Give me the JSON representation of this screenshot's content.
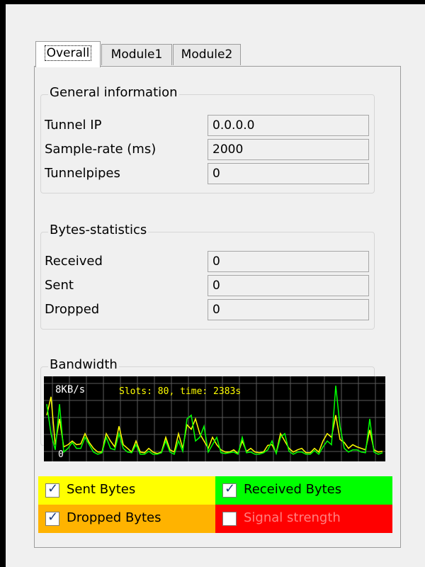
{
  "tabs": [
    {
      "label": "Overall",
      "active": true
    },
    {
      "label": "Module1",
      "active": false
    },
    {
      "label": "Module2",
      "active": false
    }
  ],
  "general": {
    "title": "General information",
    "rows": [
      {
        "label": "Tunnel IP",
        "value": "0.0.0.0"
      },
      {
        "label": "Sample-rate (ms)",
        "value": "2000"
      },
      {
        "label": "Tunnelpipes",
        "value": "0"
      }
    ]
  },
  "bytes": {
    "title": "Bytes-statistics",
    "rows": [
      {
        "label": "Received",
        "value": "0"
      },
      {
        "label": "Sent",
        "value": "0"
      },
      {
        "label": "Dropped",
        "value": "0"
      }
    ]
  },
  "bandwidth": {
    "title": "Bandwidth",
    "max_label": "8KB/s",
    "zero_label": "0",
    "status": "Slots: 80, time: 2383s"
  },
  "chart_data": {
    "type": "line",
    "y_top_label": "8KB/s",
    "y_bottom_label": "0",
    "slots": 80,
    "series": [
      {
        "color": "#ffff00",
        "values": [
          0.55,
          0.8,
          0.15,
          0.5,
          0.12,
          0.15,
          0.2,
          0.15,
          0.16,
          0.3,
          0.18,
          0.1,
          0.05,
          0.05,
          0.3,
          0.2,
          0.12,
          0.4,
          0.15,
          0.1,
          0.05,
          0.2,
          0.05,
          0.04,
          0.1,
          0.05,
          0.03,
          0.05,
          0.25,
          0.08,
          0.05,
          0.3,
          0.1,
          0.42,
          0.36,
          0.5,
          0.3,
          0.2,
          0.1,
          0.25,
          0.15,
          0.08,
          0.05,
          0.05,
          0.08,
          0.03,
          0.2,
          0.06,
          0.1,
          0.05,
          0.04,
          0.05,
          0.14,
          0.15,
          0.04,
          0.3,
          0.2,
          0.1,
          0.05,
          0.08,
          0.1,
          0.04,
          0.04,
          0.1,
          0.05,
          0.2,
          0.3,
          0.25,
          0.55,
          0.22,
          0.18,
          0.1,
          0.15,
          0.12,
          0.1,
          0.08,
          0.35,
          0.08,
          0.05,
          0.06
        ]
      },
      {
        "color": "#00ff00",
        "values": [
          0.7,
          0.3,
          0.08,
          0.7,
          0.05,
          0.1,
          0.18,
          0.1,
          0.1,
          0.25,
          0.15,
          0.05,
          0.02,
          0.04,
          0.25,
          0.1,
          0.08,
          0.3,
          0.1,
          0.05,
          0.04,
          0.15,
          0.02,
          0.02,
          0.06,
          0.02,
          0.02,
          0.04,
          0.2,
          0.05,
          0.02,
          0.2,
          0.06,
          0.5,
          0.55,
          0.2,
          0.25,
          0.4,
          0.05,
          0.15,
          0.25,
          0.04,
          0.03,
          0.04,
          0.05,
          0.02,
          0.25,
          0.04,
          0.05,
          0.02,
          0.02,
          0.04,
          0.08,
          0.2,
          0.03,
          0.25,
          0.3,
          0.06,
          0.02,
          0.05,
          0.05,
          0.02,
          0.02,
          0.07,
          0.02,
          0.12,
          0.2,
          0.15,
          0.95,
          0.4,
          0.1,
          0.05,
          0.08,
          0.08,
          0.05,
          0.04,
          0.5,
          0.05,
          0.02,
          0.04
        ]
      }
    ]
  },
  "legend": [
    {
      "label": "Sent Bytes",
      "checked": true,
      "bg": "#ffff00",
      "text_color": "#000000"
    },
    {
      "label": "Received Bytes",
      "checked": true,
      "bg": "#00ff00",
      "text_color": "#000000"
    },
    {
      "label": "Dropped Bytes",
      "checked": true,
      "bg": "#ffb300",
      "text_color": "#000000"
    },
    {
      "label": "Signal strength",
      "checked": false,
      "bg": "#ff0000",
      "text_color": "#ff8080"
    }
  ]
}
